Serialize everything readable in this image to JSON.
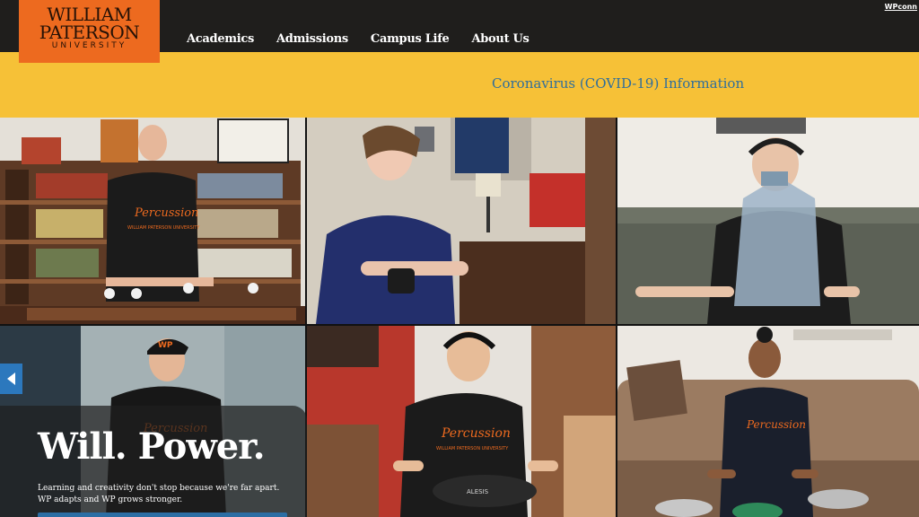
{
  "logo": {
    "line1": "WILLIAM",
    "line2": "PATERSON",
    "line3": "UNIVERSITY"
  },
  "nav": {
    "items": [
      "Academics",
      "Admissions",
      "Campus Life",
      "About Us"
    ]
  },
  "corner_link": "WPconn",
  "alert": {
    "text": "Coronavirus (COVID-19) Information"
  },
  "hero": {
    "headline": "Will. Power.",
    "body_line1": "Learning and creativity don't stop because we're far apart.",
    "body_line2": "WP adapts and WP grows stronger."
  },
  "tshirt_text": {
    "brand": "Percussion",
    "sub": "WILLIAM PATERSON UNIVERSITY"
  },
  "cap_text": "WP",
  "drum_text": "ALESIS",
  "icons": {
    "carousel_prev": "chevron-left-icon"
  },
  "colors": {
    "brand_orange": "#ed6a1f",
    "topbar": "#1f1e1c",
    "alert_bg": "#f6c137",
    "link_blue": "#2f6e9c",
    "button_blue": "#2c78bd"
  }
}
